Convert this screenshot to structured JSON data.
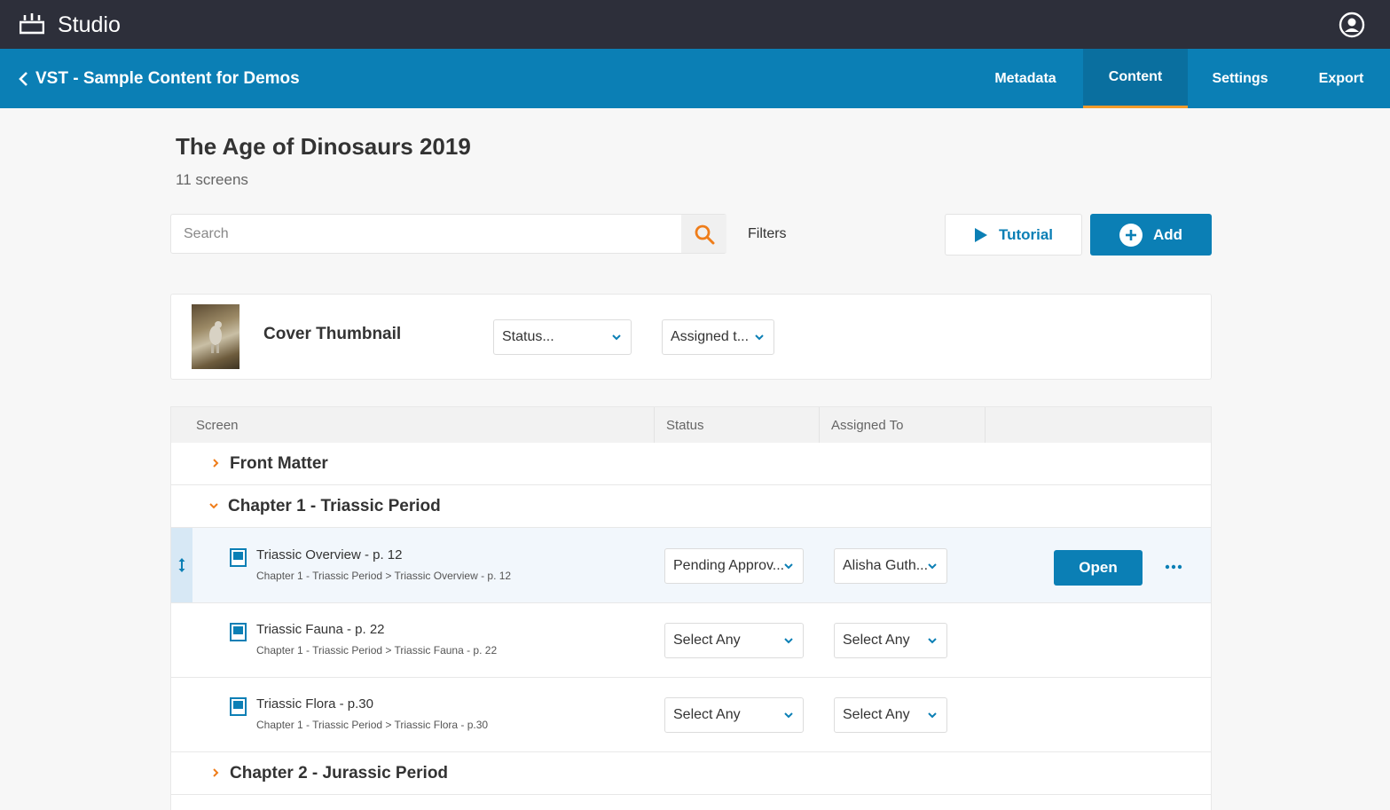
{
  "app": {
    "title": "Studio"
  },
  "nav": {
    "back_title": "VST - Sample Content for Demos",
    "tabs": [
      {
        "label": "Metadata",
        "active": false
      },
      {
        "label": "Content",
        "active": true
      },
      {
        "label": "Settings",
        "active": false
      },
      {
        "label": "Export",
        "active": false
      }
    ]
  },
  "content": {
    "title": "The Age of Dinosaurs 2019",
    "subtitle": "11 screens"
  },
  "toolbar": {
    "search_placeholder": "Search",
    "search_value": "",
    "filters_label": "Filters",
    "tutorial_label": "Tutorial",
    "add_label": "Add"
  },
  "cover": {
    "label": "Cover Thumbnail",
    "status_value": "Status...",
    "assigned_value": "Assigned t..."
  },
  "table": {
    "headers": [
      "Screen",
      "Status",
      "Assigned To"
    ],
    "groups": [
      {
        "label": "Front Matter",
        "expanded": false
      },
      {
        "label": "Chapter 1 - Triassic Period",
        "expanded": true
      },
      {
        "label": "Chapter 2 - Jurassic Period",
        "expanded": false
      }
    ],
    "screens": [
      {
        "title": "Triassic Overview - p. 12",
        "path": "Chapter 1 - Triassic Period > Triassic Overview - p. 12",
        "status": "Pending Approv...",
        "assigned": "Alisha Guth...",
        "open_label": "Open",
        "selected": true
      },
      {
        "title": "Triassic Fauna - p. 22",
        "path": "Chapter 1 - Triassic Period > Triassic Fauna - p. 22",
        "status": "Select Any",
        "assigned": "Select Any"
      },
      {
        "title": "Triassic Flora - p.30",
        "path": "Chapter 1 - Triassic Period > Triassic Flora - p.30",
        "status": "Select Any",
        "assigned": "Select Any"
      }
    ]
  },
  "colors": {
    "topbar": "#2d2f3a",
    "brand_blue": "#0b7fb5",
    "accent_orange": "#f29b2b",
    "selected_row": "#f2f7fc"
  },
  "icons": {
    "logo": "studio-logo-icon",
    "account": "user-circle-icon",
    "back": "chevron-left-icon",
    "search": "search-icon",
    "tutorial": "play-icon",
    "add": "plus-circle-icon",
    "dropdown": "chevron-down-icon",
    "collapsed": "chevron-right-icon",
    "expanded": "chevron-down-icon",
    "screen": "screen-page-icon",
    "drag": "drag-vertical-icon",
    "more": "more-horizontal-icon"
  }
}
